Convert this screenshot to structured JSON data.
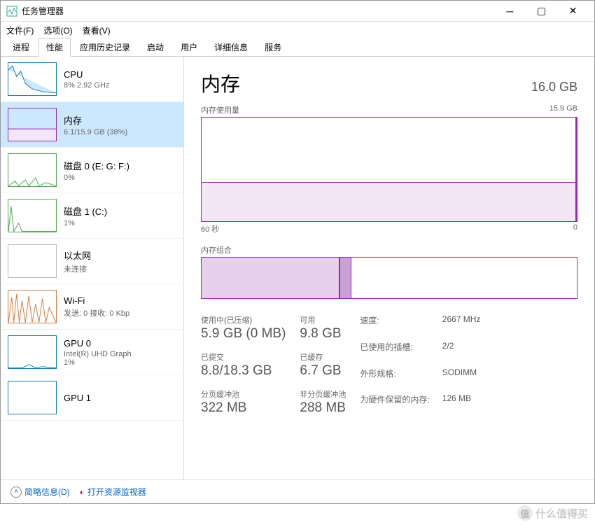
{
  "window": {
    "title": "任务管理器"
  },
  "menu": {
    "file": "文件(F)",
    "options": "选项(O)",
    "view": "查看(V)"
  },
  "tabs": [
    "进程",
    "性能",
    "应用历史记录",
    "启动",
    "用户",
    "详细信息",
    "服务"
  ],
  "active_tab_index": 1,
  "sidebar": [
    {
      "name": "CPU",
      "sub": "8% 2.92 GHz",
      "color": "blue"
    },
    {
      "name": "内存",
      "sub": "6.1/15.9 GB (38%)",
      "color": "purple",
      "selected": true
    },
    {
      "name": "磁盘 0 (E: G: F:)",
      "sub": "0%",
      "color": "green"
    },
    {
      "name": "磁盘 1 (C:)",
      "sub": "1%",
      "color": "green"
    },
    {
      "name": "以太网",
      "sub": "未连接",
      "color": "gray"
    },
    {
      "name": "Wi-Fi",
      "sub": "发送: 0 接收: 0 Kbp",
      "color": "orange"
    },
    {
      "name": "GPU 0",
      "sub": "Intel(R) UHD Graph\n1%",
      "color": "blue"
    },
    {
      "name": "GPU 1",
      "sub": "",
      "color": "blue"
    }
  ],
  "main": {
    "title": "内存",
    "total": "16.0 GB",
    "usage_label": "内存使用量",
    "usage_max": "15.9 GB",
    "axis_left": "60 秒",
    "axis_right": "0",
    "composition_label": "内存组合",
    "stats": {
      "in_use_label": "使用中(已压缩)",
      "in_use_value": "5.9 GB (0 MB)",
      "available_label": "可用",
      "available_value": "9.8 GB",
      "committed_label": "已提交",
      "committed_value": "8.8/18.3 GB",
      "cached_label": "已缓存",
      "cached_value": "6.7 GB",
      "paged_label": "分页缓冲池",
      "paged_value": "322 MB",
      "nonpaged_label": "非分页缓冲池",
      "nonpaged_value": "288 MB"
    },
    "specs": {
      "speed_k": "速度:",
      "speed_v": "2667 MHz",
      "slots_k": "已使用的插槽:",
      "slots_v": "2/2",
      "form_k": "外形规格:",
      "form_v": "SODIMM",
      "reserved_k": "为硬件保留的内存:",
      "reserved_v": "126 MB"
    }
  },
  "footer": {
    "brief": "简略信息(D)",
    "resmon": "打开资源监视器"
  },
  "watermark": "什么值得买",
  "chart_data": {
    "type": "area",
    "title": "内存使用量",
    "xlabel": "60 秒 → 0",
    "ylabel": "GB",
    "ylim": [
      0,
      15.9
    ],
    "x": [
      60,
      50,
      40,
      30,
      20,
      10,
      0
    ],
    "values": [
      6.0,
      6.0,
      6.0,
      6.1,
      6.1,
      6.1,
      6.1
    ],
    "series_name": "内存",
    "composition": {
      "in_use_pct": 37,
      "modified_pct": 3,
      "standby_free_pct": 60
    }
  }
}
